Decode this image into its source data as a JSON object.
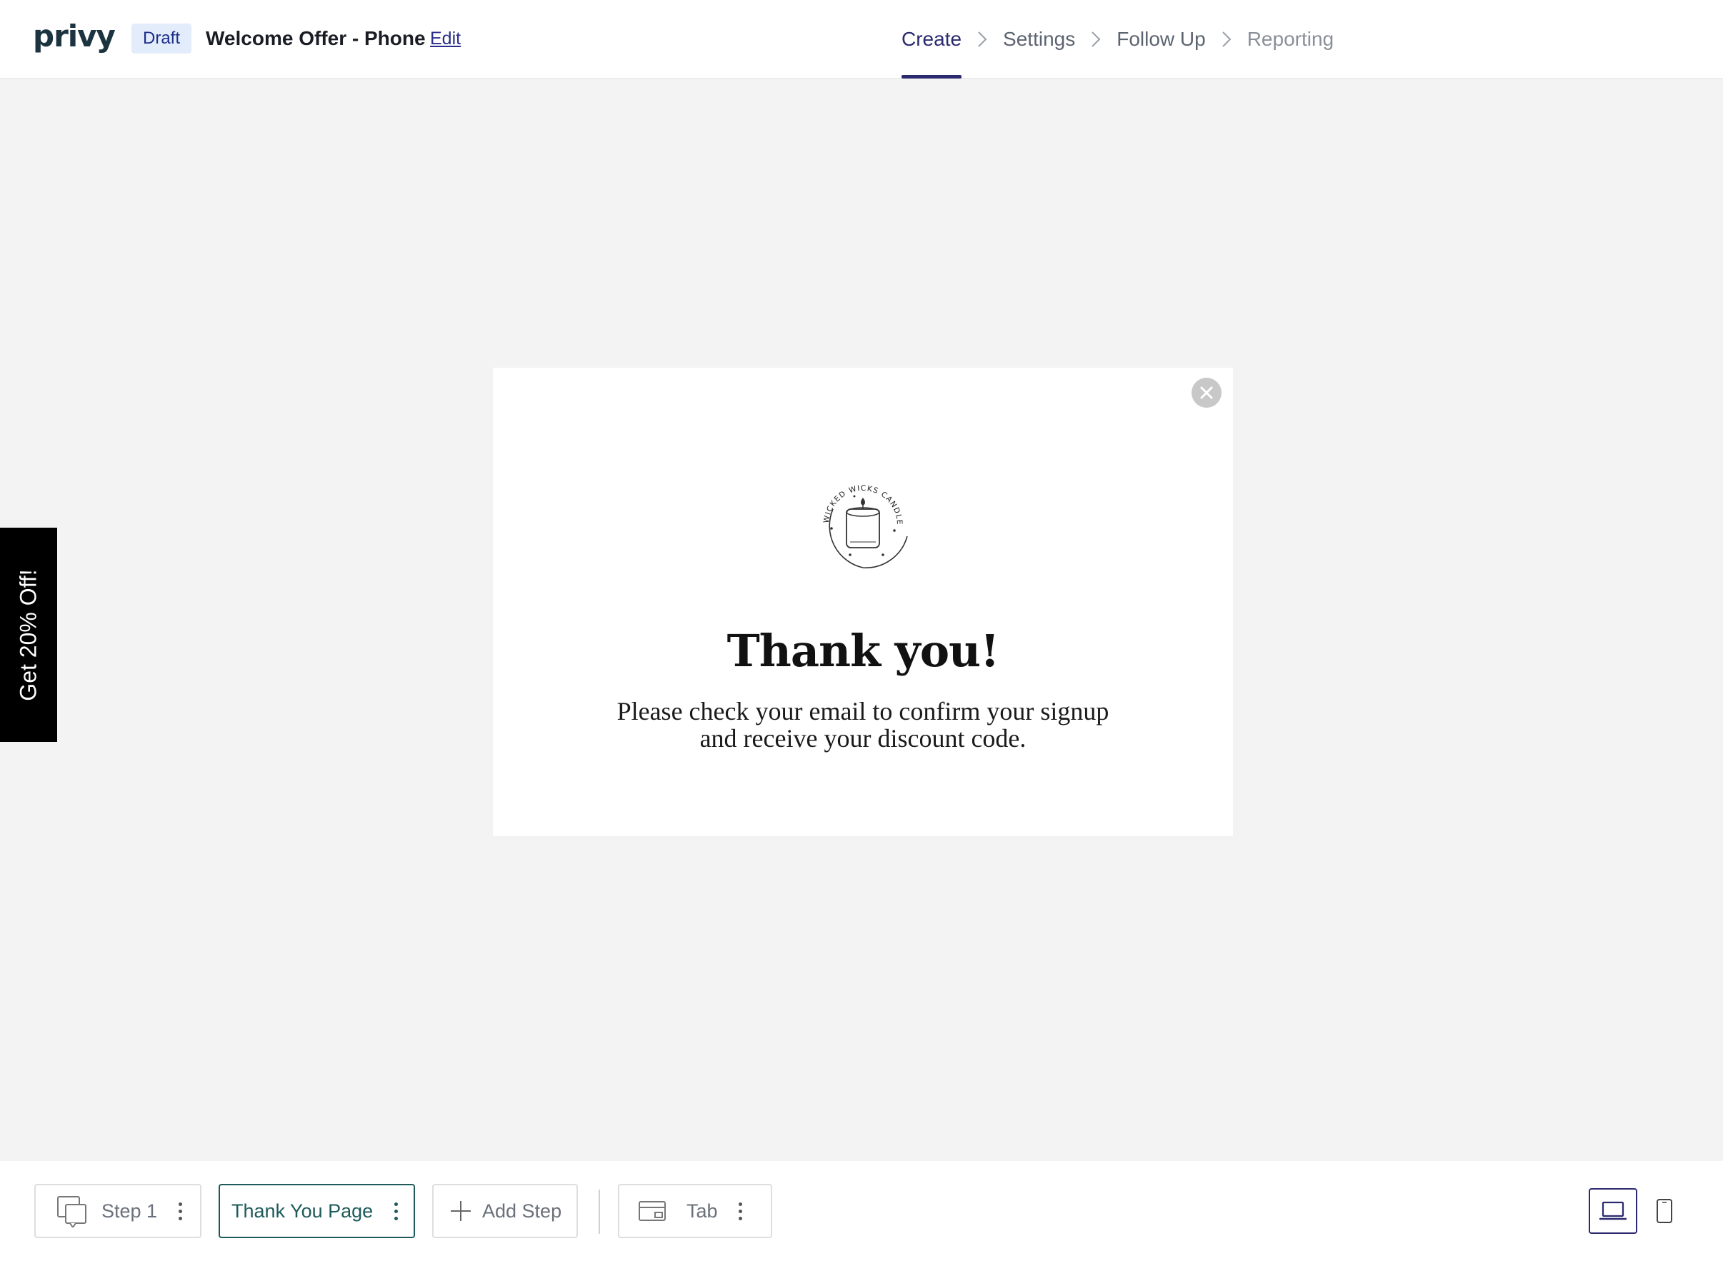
{
  "header": {
    "logo": "privy",
    "status_badge": "Draft",
    "campaign_title": "Welcome Offer - Phone",
    "edit_label": "Edit",
    "steps": [
      {
        "label": "Create",
        "state": "active"
      },
      {
        "label": "Settings",
        "state": "default"
      },
      {
        "label": "Follow Up",
        "state": "default"
      },
      {
        "label": "Reporting",
        "state": "muted"
      }
    ]
  },
  "side_tab": {
    "label": "Get 20% Off!"
  },
  "modal": {
    "logo_text": "WICKED WICKS CANDLE CO.",
    "title": "Thank you!",
    "body_line1": "Please check your email to confirm your signup",
    "body_line2": "and receive your discount code."
  },
  "footer": {
    "step1_label": "Step 1",
    "thank_you_label": "Thank You Page",
    "add_step_label": "Add Step",
    "tab_label": "Tab"
  },
  "colors": {
    "accent": "#2b2a6f",
    "selected_step": "#1e5a5a",
    "badge_bg": "#e3ecfb",
    "canvas_bg": "#f3f3f3"
  }
}
